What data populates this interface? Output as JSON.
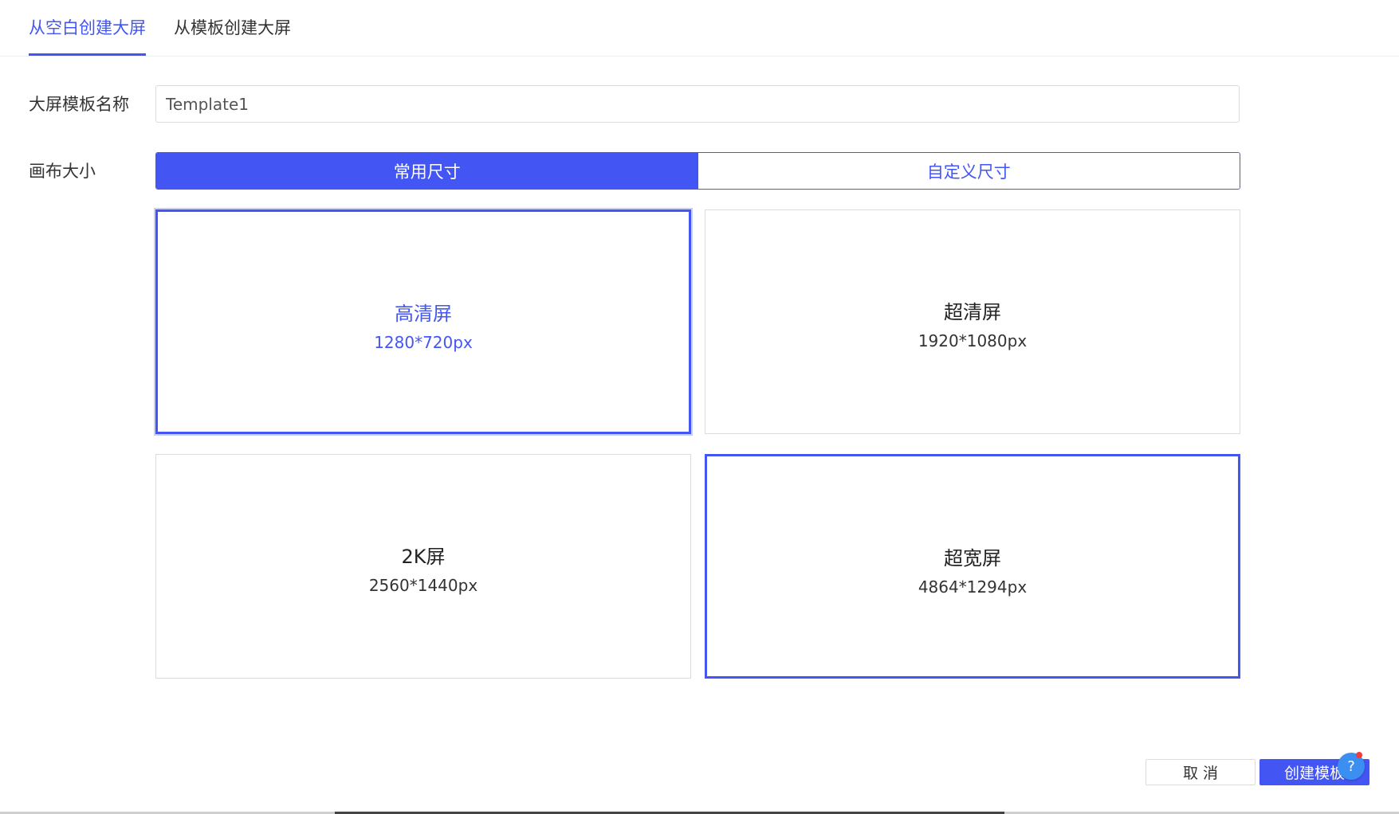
{
  "tabs": [
    {
      "label": "从空白创建大屏",
      "active": true
    },
    {
      "label": "从模板创建大屏",
      "active": false
    }
  ],
  "form": {
    "name_label": "大屏模板名称",
    "name_value": "Template1",
    "size_label": "画布大小"
  },
  "size_mode": {
    "common_label": "常用尺寸",
    "custom_label": "自定义尺寸",
    "selected": "常用尺寸"
  },
  "sizes": [
    {
      "title": "高清屏",
      "dims": "1280*720px"
    },
    {
      "title": "超清屏",
      "dims": "1920*1080px"
    },
    {
      "title": "2K屏",
      "dims": "2560*1440px"
    },
    {
      "title": "超宽屏",
      "dims": "4864*1294px"
    }
  ],
  "footer": {
    "cancel_label": "取 消",
    "create_label": "创建模板",
    "help_label": "?"
  },
  "colors": {
    "accent": "#4356f3",
    "help": "#3b8ff0",
    "notification_dot": "#f23b3b"
  }
}
